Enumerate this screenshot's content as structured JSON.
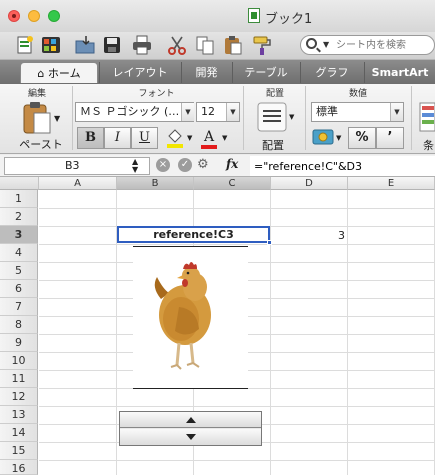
{
  "window": {
    "title": "ブック1"
  },
  "toolbar": {
    "search_placeholder": "シート内を検索"
  },
  "tabs": [
    "ホーム",
    "レイアウト",
    "開発",
    "テーブル",
    "グラフ",
    "SmartArt"
  ],
  "ribbon": {
    "edit_group": "編集",
    "font_group": "フォント",
    "align_group": "配置",
    "number_group": "数値",
    "paste_label": "ペースト",
    "font_name": "ＭＳ Ｐゴシック (…",
    "font_size": "12",
    "bold": "B",
    "italic": "I",
    "underline": "U",
    "font_color_glyph": "A",
    "align_label": "配置",
    "number_format": "標準",
    "percent": "%",
    "comma": "’",
    "conditional_label": "条"
  },
  "formula_bar": {
    "cell_name": "B3",
    "fx": "fx",
    "formula": "=\"reference!C\"&D3"
  },
  "sheet": {
    "columns": [
      "A",
      "B",
      "C",
      "D",
      "E"
    ],
    "rows": [
      "1",
      "2",
      "3",
      "4",
      "5",
      "6",
      "7",
      "8",
      "9",
      "10",
      "11",
      "12",
      "13",
      "14",
      "15",
      "16"
    ],
    "selected_cell": "B3",
    "cells": {
      "B3": "reference!C3",
      "D3": "3"
    }
  },
  "colors": {
    "selection": "#2e5dc0",
    "accent_green": "#2f8f2f"
  },
  "icons": [
    "new-workbook-icon",
    "template-icon",
    "open-icon",
    "save-icon",
    "print-icon",
    "cut-icon",
    "copy-icon",
    "paste-icon",
    "format-painter-icon",
    "search-icon",
    "chicken-picture",
    "spin-up-icon",
    "spin-down-icon"
  ]
}
